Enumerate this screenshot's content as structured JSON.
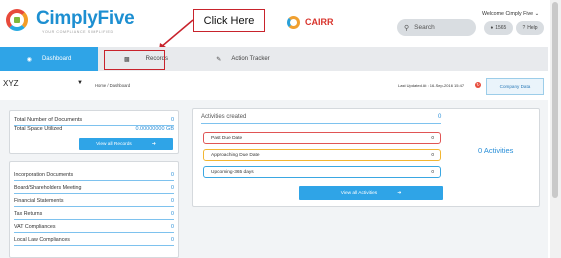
{
  "header": {
    "brand": "CimplyFive",
    "tagline": "YOUR COMPLIANCE SIMPLIFIED",
    "callout": "Click Here",
    "partner": "CAIRR",
    "search_placeholder": "Search",
    "welcome": "Welcome Cimply  Five",
    "notifications": "1565",
    "help": "Help"
  },
  "tabs": {
    "dashboard": "Dashboard",
    "records": "Records",
    "tracker": "Action Tracker"
  },
  "subbar": {
    "company": "XYZ",
    "breadcrumb": "Home  /  Dashboard",
    "last_updated": "Last Updated At : 16-Sep-2016 15:47",
    "company_data_button": "Company Data"
  },
  "totals": {
    "documents_label": "Total Number of Documents",
    "documents_value": "0",
    "space_label": "Total Space Utilized",
    "space_value": "0.00000000 GB",
    "view_records_button": "View all Records"
  },
  "categories": [
    {
      "label": "Incorporation Documents",
      "value": "0"
    },
    {
      "label": "Board/Shareholders Meeting",
      "value": "0"
    },
    {
      "label": "Financial Statements",
      "value": "0"
    },
    {
      "label": "Tax Returns",
      "value": "0"
    },
    {
      "label": "VAT Compliances",
      "value": "0"
    },
    {
      "label": "Local Law Compliances",
      "value": "0"
    }
  ],
  "activities": {
    "title": "Activities created",
    "count": "0",
    "items": [
      {
        "label": "Past Due Date",
        "value": "0"
      },
      {
        "label": "Approaching Due Date",
        "value": "0"
      },
      {
        "label": "Upcoming-365 days",
        "value": "0"
      }
    ],
    "view_button": "View all Activities",
    "summary": "0 Activities"
  },
  "colors": {
    "accent": "#2fa4e7",
    "callout_red": "#c8232c",
    "past_due": "#e05555",
    "approaching": "#f2b632",
    "upcoming": "#3aa7e2"
  }
}
